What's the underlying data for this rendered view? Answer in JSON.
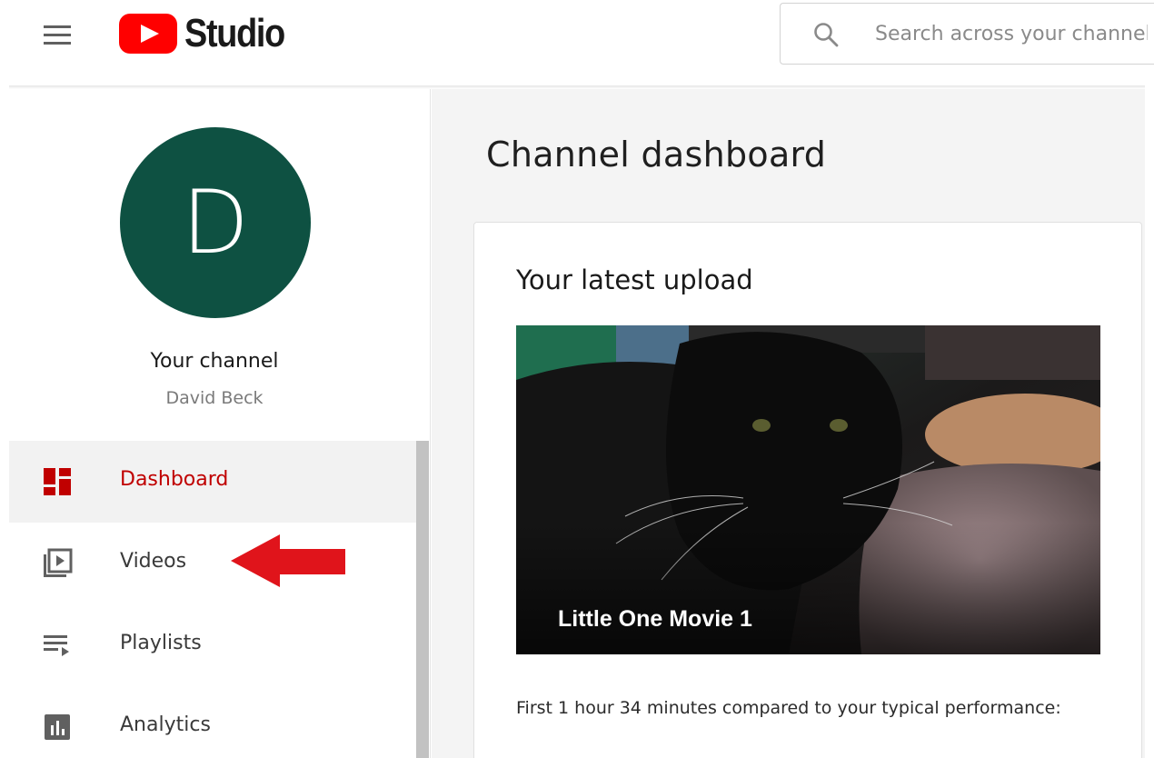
{
  "header": {
    "logo_text": "Studio",
    "search_placeholder": "Search across your channel"
  },
  "sidebar": {
    "avatar_letter": "D",
    "channel_title": "Your channel",
    "channel_name": "David Beck",
    "items": [
      {
        "label": "Dashboard",
        "icon": "dashboard-icon",
        "active": true
      },
      {
        "label": "Videos",
        "icon": "video-library-icon",
        "active": false
      },
      {
        "label": "Playlists",
        "icon": "playlist-icon",
        "active": false
      },
      {
        "label": "Analytics",
        "icon": "analytics-icon",
        "active": false
      }
    ]
  },
  "main": {
    "page_title": "Channel dashboard",
    "card": {
      "title": "Your latest upload",
      "video_title": "Little One Movie 1",
      "performance_text": "First 1 hour 34 minutes compared to your typical performance:"
    }
  },
  "colors": {
    "brand_red": "#ff0000",
    "active_red": "#c00000",
    "avatar_bg": "#0e5142",
    "annotation_arrow": "#e0141b"
  }
}
